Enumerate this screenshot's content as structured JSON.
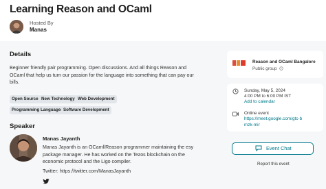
{
  "event": {
    "title": "Learning Reason and OCaml",
    "host": {
      "label": "Hosted By",
      "name": "Manas"
    }
  },
  "details": {
    "heading": "Details",
    "description": "Beginner friendly pair programming. Open discussions. And all things Reason and OCaml that help us turn our passion for the language into something that can pay our bills.",
    "tags": [
      "Open Source",
      "New Technology",
      "Web Development",
      "Programming Languages",
      "Software Development"
    ]
  },
  "speaker": {
    "heading": "Speaker",
    "name": "Manas Jayanth",
    "bio": "Manas Jayanth is an OCaml/Reason programmer maintaining the esy package manager. He has worked on the Tezos blockchain on the economic protocol and the Ligo compiler.",
    "twitter_text": "Twitter: https://twitter.com/ManasJayanth"
  },
  "sidebar": {
    "group": {
      "name": "Reason and OCaml Bangalore",
      "type": "Public group"
    },
    "when": {
      "date": "Sunday, May 5, 2024",
      "time": "4:00 PM to 6:00 PM IST",
      "add_to_calendar": "Add to calendar"
    },
    "where": {
      "type": "Online event",
      "link": "https://meet.google.com/gtc-bmzk-mir"
    },
    "chat_button": "Event Chat",
    "report": "Report this event"
  },
  "icons": {
    "calendar": "clock-icon",
    "online": "video-icon",
    "chat": "chat-bubble-icon",
    "social": "twitter-icon"
  },
  "colors": {
    "accent": "#00798a",
    "background": "#f6f7f8",
    "tag_bg": "#e2e6ea"
  }
}
